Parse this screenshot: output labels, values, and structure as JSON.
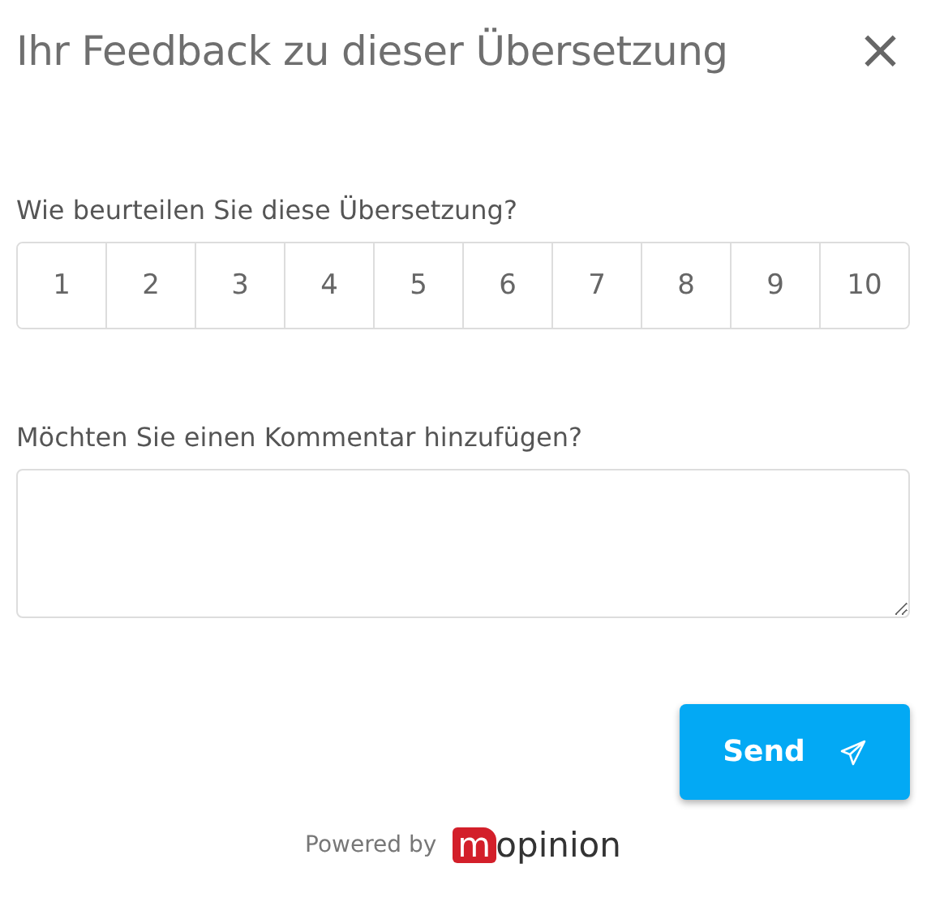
{
  "title": "Ihr Feedback zu dieser Übersetzung",
  "close": "×",
  "rating": {
    "question": "Wie beurteilen Sie diese Übersetzung?",
    "options": [
      {
        "label": "1",
        "selected": false
      },
      {
        "label": "2",
        "selected": false
      },
      {
        "label": "3",
        "selected": false
      },
      {
        "label": "4",
        "selected": false
      },
      {
        "label": "5",
        "selected": false
      },
      {
        "label": "6",
        "selected": false
      },
      {
        "label": "7",
        "selected": false
      },
      {
        "label": "8",
        "selected": false
      },
      {
        "label": "9",
        "selected": false
      },
      {
        "label": "10",
        "selected": false
      }
    ]
  },
  "comment": {
    "question": "Möchten Sie einen Kommentar hinzufügen?"
  },
  "send_button": "Send",
  "footer": {
    "powered_by": "Powered by",
    "logo": {
      "badge": "m",
      "text": "opinion"
    }
  }
}
